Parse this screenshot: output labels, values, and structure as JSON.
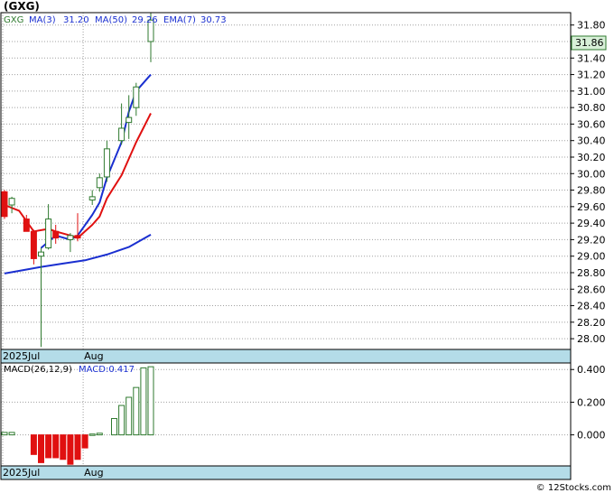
{
  "header": {
    "ticker": "(GXG)",
    "legend_ticker": "GXG",
    "ma3_label": "MA(3)",
    "ma3_value": "31.20",
    "ma50_label": "MA(50)",
    "ma50_value": "29.26",
    "ema7_label": "EMA(7)",
    "ema7_value": "30.73"
  },
  "macd_header": {
    "params_label": "MACD(26,12,9)",
    "value_label": "MACD:0.417"
  },
  "last_price_tag": "31.86",
  "watermark": "© 12Stocks.com",
  "colors": {
    "up": "#2f7a2f",
    "down": "#e01010",
    "ma": "#1a2fd0",
    "ema": "#e01010",
    "axis_band": "#b4dce8"
  },
  "chart_data": [
    {
      "type": "candlestick",
      "title": "",
      "y_ticks": [
        28.0,
        28.2,
        28.4,
        28.6,
        28.8,
        29.0,
        29.2,
        29.4,
        29.6,
        29.8,
        30.0,
        30.2,
        30.4,
        30.6,
        30.8,
        31.0,
        31.2,
        31.4,
        31.6,
        31.8
      ],
      "ylim": [
        27.87,
        31.95
      ],
      "x_labels": [
        {
          "label": "2025Jul",
          "index": 0
        },
        {
          "label": "Aug",
          "index": 11
        }
      ],
      "grid": true,
      "candles": [
        {
          "o": 29.78,
          "h": 29.8,
          "l": 29.45,
          "c": 29.48
        },
        {
          "o": 29.62,
          "h": 29.72,
          "l": 29.52,
          "c": 29.7
        },
        {
          "o": 29.45,
          "h": 29.5,
          "l": 29.3,
          "c": 29.3
        },
        {
          "o": 29.3,
          "h": 29.32,
          "l": 28.9,
          "c": 28.97
        },
        {
          "o": 29.0,
          "h": 29.1,
          "l": 27.9,
          "c": 29.05
        },
        {
          "o": 29.1,
          "h": 29.63,
          "l": 29.08,
          "c": 29.45
        },
        {
          "o": 29.3,
          "h": 29.38,
          "l": 29.15,
          "c": 29.22
        },
        {
          "o": 29.2,
          "h": 29.28,
          "l": 29.05,
          "c": 29.25
        },
        {
          "o": 29.25,
          "h": 29.52,
          "l": 29.18,
          "c": 29.22
        },
        {
          "o": 29.68,
          "h": 29.8,
          "l": 29.62,
          "c": 29.72
        },
        {
          "o": 29.83,
          "h": 30.0,
          "l": 29.78,
          "c": 29.95
        },
        {
          "o": 29.96,
          "h": 30.4,
          "l": 29.9,
          "c": 30.3
        },
        {
          "o": 30.4,
          "h": 30.85,
          "l": 30.35,
          "c": 30.55
        },
        {
          "o": 30.62,
          "h": 30.95,
          "l": 30.42,
          "c": 30.68
        },
        {
          "o": 30.8,
          "h": 31.1,
          "l": 30.7,
          "c": 31.05
        },
        {
          "o": 31.6,
          "h": 31.95,
          "l": 31.35,
          "c": 31.86
        }
      ],
      "candle_x_index": [
        0,
        1,
        3,
        4,
        5,
        6,
        7,
        8,
        9,
        11,
        12,
        13,
        14,
        15,
        16,
        17,
        18,
        19,
        20
      ],
      "candle_slots": [
        0,
        1,
        3,
        4,
        5,
        6,
        7,
        9,
        10,
        12,
        13,
        14,
        16,
        17,
        18,
        20
      ],
      "series": [
        {
          "name": "MA(50)",
          "slots": [
            0,
            5,
            8,
            11,
            14,
            17,
            20
          ],
          "values": [
            28.79,
            28.87,
            28.91,
            28.95,
            29.02,
            29.11,
            29.26
          ]
        },
        {
          "name": "MA(3)",
          "slots": [
            5,
            7,
            9,
            10,
            12,
            13,
            14,
            16,
            17,
            18,
            20
          ],
          "values": [
            29.1,
            29.25,
            29.2,
            29.25,
            29.5,
            29.65,
            29.95,
            30.38,
            30.75,
            31.0,
            31.2
          ]
        },
        {
          "name": "EMA(7)",
          "slots": [
            0,
            2,
            4,
            6,
            7,
            9,
            10,
            11,
            12,
            13,
            14,
            16,
            18,
            20
          ],
          "values": [
            29.62,
            29.55,
            29.3,
            29.33,
            29.3,
            29.25,
            29.22,
            29.3,
            29.38,
            29.48,
            29.7,
            29.98,
            30.38,
            30.73
          ]
        }
      ]
    },
    {
      "type": "bar",
      "title": "MACD(26,12,9)",
      "y_ticks": [
        0.0,
        0.2,
        0.4
      ],
      "ylim": [
        -0.19,
        0.44
      ],
      "slots": [
        0,
        1,
        4,
        5,
        6,
        7,
        8,
        9,
        10,
        11,
        12,
        13,
        15,
        16,
        17,
        18,
        19,
        20
      ],
      "values": [
        0.015,
        0.015,
        -0.12,
        -0.17,
        -0.14,
        -0.14,
        -0.15,
        -0.18,
        -0.15,
        -0.08,
        0.005,
        0.01,
        0.1,
        0.18,
        0.23,
        0.29,
        0.41,
        0.417
      ]
    }
  ]
}
